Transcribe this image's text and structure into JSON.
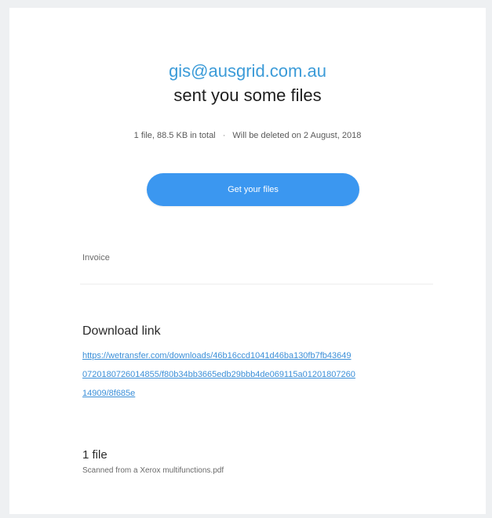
{
  "email": {
    "sender": "gis@ausgrid.com.au",
    "headline": "sent you some files",
    "meta": {
      "summary": "1 file, 88.5 KB in total",
      "separator": "·",
      "expiry": "Will be deleted on 2 August, 2018"
    },
    "cta_label": "Get your files",
    "message": "Invoice",
    "download": {
      "title": "Download link",
      "url_lines": [
        "https://wetransfer.com/downloads/46b16ccd1041d46ba130fb7fb43649",
        "0720180726014855/f80b34bb3665edb29bbb4de069115a01201807260",
        "14909/8f685e"
      ]
    },
    "files": {
      "count_label": "1 file",
      "items": [
        "Scanned from a Xerox multifunctions.pdf"
      ]
    }
  },
  "colors": {
    "accent": "#3b97f0",
    "link": "#3b8fd8",
    "sender": "#3b9bd8",
    "background": "#eef0f2"
  }
}
